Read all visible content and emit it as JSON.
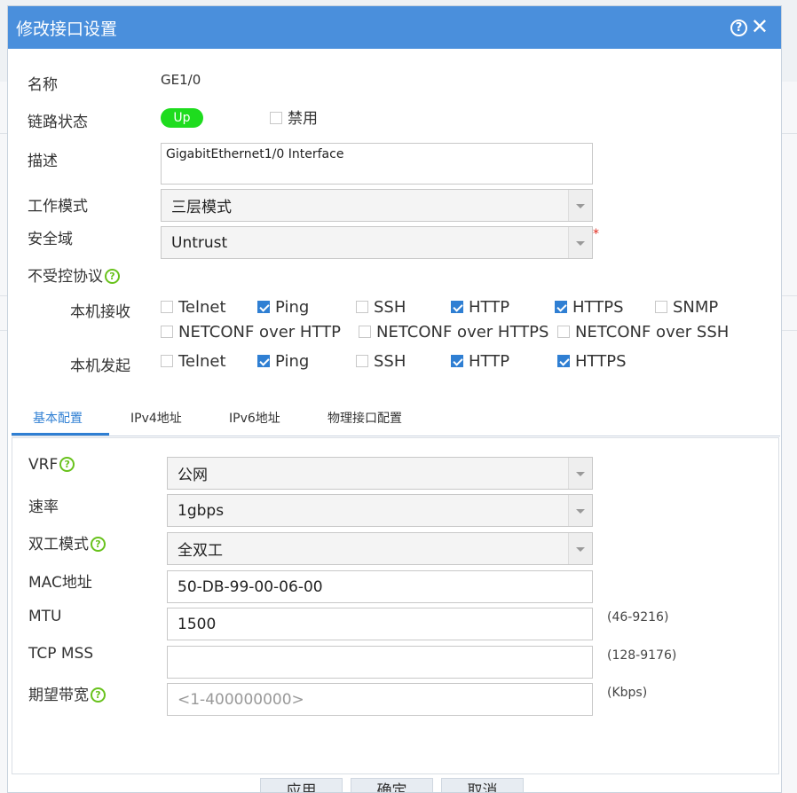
{
  "dialog": {
    "title": "修改接口设置",
    "help_icon": "question-circle-icon",
    "close_icon": "close-icon"
  },
  "form": {
    "name_label": "名称",
    "name_value": "GE1/0",
    "link_status_label": "链路状态",
    "link_status_value": "Up",
    "disable_label": "禁用",
    "description_label": "描述",
    "description_value": "GigabitEthernet1/0 Interface",
    "work_mode_label": "工作模式",
    "work_mode_value": "三层模式",
    "security_zone_label": "安全域",
    "security_zone_value": "Untrust",
    "uncontrolled_protocols_label": "不受控协议",
    "local_receive_label": "本机接收",
    "local_send_label": "本机发起",
    "receive_options": [
      {
        "label": "Telnet",
        "checked": false
      },
      {
        "label": "Ping",
        "checked": true
      },
      {
        "label": "SSH",
        "checked": false
      },
      {
        "label": "HTTP",
        "checked": true
      },
      {
        "label": "HTTPS",
        "checked": true
      },
      {
        "label": "SNMP",
        "checked": false
      },
      {
        "label": "NETCONF over HTTP",
        "checked": false
      },
      {
        "label": "NETCONF over HTTPS",
        "checked": false
      },
      {
        "label": "NETCONF over SSH",
        "checked": false
      }
    ],
    "send_options": [
      {
        "label": "Telnet",
        "checked": false
      },
      {
        "label": "Ping",
        "checked": true
      },
      {
        "label": "SSH",
        "checked": false
      },
      {
        "label": "HTTP",
        "checked": true
      },
      {
        "label": "HTTPS",
        "checked": true
      }
    ]
  },
  "tabs": [
    {
      "label": "基本配置",
      "active": true
    },
    {
      "label": "IPv4地址",
      "active": false
    },
    {
      "label": "IPv6地址",
      "active": false
    },
    {
      "label": "物理接口配置",
      "active": false
    }
  ],
  "basic": {
    "vrf_label": "VRF",
    "vrf_value": "公网",
    "rate_label": "速率",
    "rate_value": "1gbps",
    "duplex_label": "双工模式",
    "duplex_value": "全双工",
    "mac_label": "MAC地址",
    "mac_value": "50-DB-99-00-06-00",
    "mtu_label": "MTU",
    "mtu_value": "1500",
    "mtu_hint": "(46-9216)",
    "tcpmss_label": "TCP MSS",
    "tcpmss_value": "",
    "tcpmss_hint": "(128-9176)",
    "bandwidth_label": "期望带宽",
    "bandwidth_placeholder": "<1-400000000>",
    "bandwidth_hint": "(Kbps)"
  },
  "footer": {
    "apply_label": "应用",
    "ok_label": "确定",
    "cancel_label": "取消"
  },
  "colors": {
    "titlebar": "#4a8fdc",
    "accent": "#2f7fd3",
    "status_up": "#1edc1e",
    "help_green": "#69c21d",
    "required": "#e0291c"
  }
}
